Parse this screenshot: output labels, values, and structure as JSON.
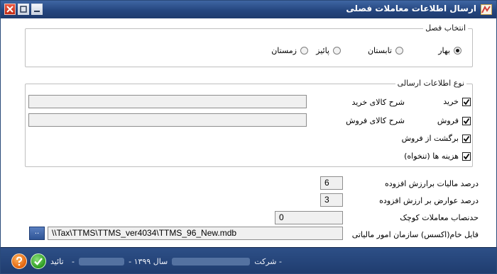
{
  "window": {
    "title": "ارسال اطلاعات معاملات فصلی"
  },
  "season": {
    "legend": "انتخاب فصل",
    "options": [
      "بهار",
      "تابستان",
      "پائیز",
      "زمستان"
    ],
    "selected": "بهار"
  },
  "info": {
    "legend": "نوع اطلاعات ارسالی",
    "purchase": {
      "label": "خرید",
      "checked": true,
      "desc_label": "شرح کالای خرید",
      "desc_value": ""
    },
    "sale": {
      "label": "فروش",
      "checked": true,
      "desc_label": "شرح کالای فروش",
      "desc_value": ""
    },
    "sale_return": {
      "label": "برگشت از فروش",
      "checked": true
    },
    "expenses": {
      "label": "هزینه ها (تنخواه)",
      "checked": true
    }
  },
  "settings": {
    "vat_percent": {
      "label": "درصد مالیات برارزش افزوده",
      "value": "6"
    },
    "duties_percent": {
      "label": "درصد عوارض بر ارزش افزوده",
      "value": "3"
    },
    "small_threshold": {
      "label": "حدنصاب معاملات کوچک",
      "value": "0"
    },
    "access_file": {
      "label": "فایل خام(اکسس) سازمان امور مالیاتی",
      "value": "\\\\Tax\\TTMS\\TTMS_ver4034\\TTMS_96_New.mdb",
      "browse_label": ".."
    }
  },
  "status": {
    "company_prefix": "- شرکت",
    "year_label": "سال ۱۳۹۹ -",
    "suffix": "-",
    "confirm_label": "تائید"
  },
  "colors": {
    "titlebar": "#25467f",
    "statusbar": "#1f3c6e",
    "field_bg": "#f0f0f0"
  }
}
